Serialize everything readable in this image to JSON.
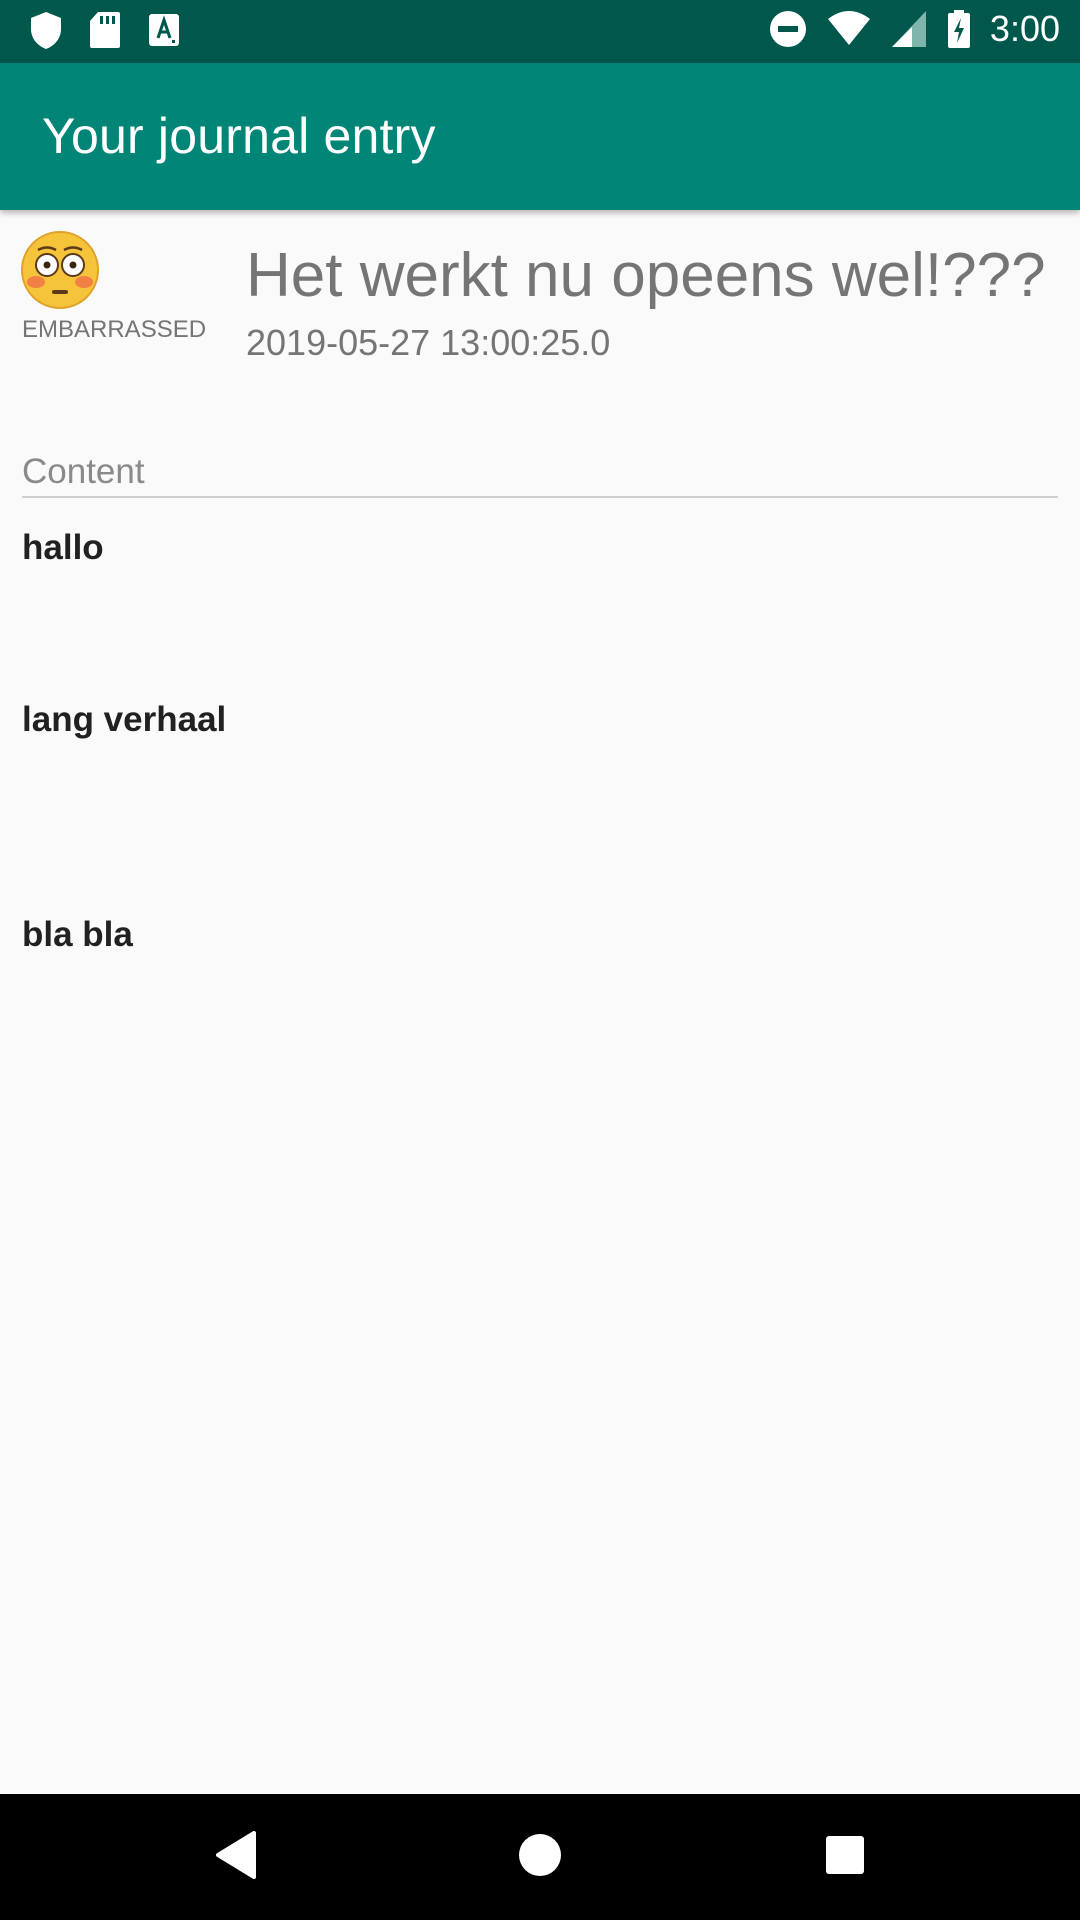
{
  "status_bar": {
    "time": "3:00",
    "icons": [
      "shield-icon",
      "sd-card-icon",
      "text-badge-icon",
      "do-not-disturb-icon",
      "wifi-icon",
      "signal-icon",
      "battery-charging-icon"
    ],
    "color": "#00574b"
  },
  "app_bar": {
    "title": "Your journal entry",
    "color": "#008577"
  },
  "entry": {
    "mood_icon": "embarrassed-face-emoji",
    "mood_label": "EMBARRASSED",
    "title": "Het werkt nu opeens wel!???",
    "date": "2019-05-27 13:00:25.0"
  },
  "content": {
    "label": "Content",
    "lines": [
      "hallo",
      "lang verhaal",
      "bla bla"
    ]
  },
  "nav_bar": {
    "icons": [
      "back-icon",
      "home-icon",
      "recents-icon"
    ]
  }
}
